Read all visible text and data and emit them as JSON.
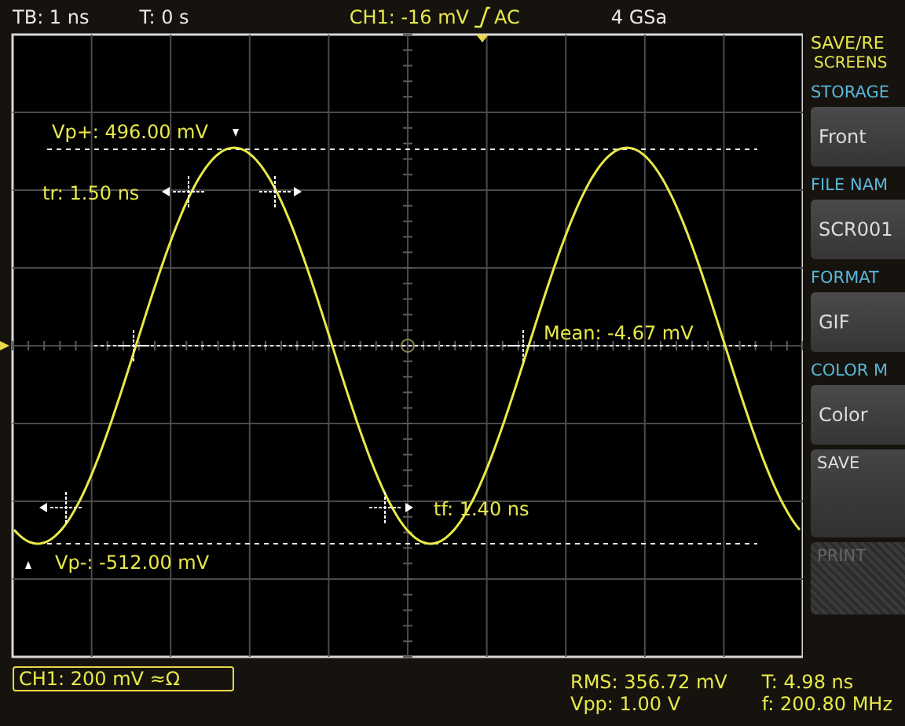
{
  "top_bar": {
    "timebase": "TB: 1 ns",
    "trigger_time": "T: 0 s",
    "channel": "CH1: -16 mV",
    "coupling": "AC",
    "sample_rate": "4 GSa"
  },
  "screen_labels": [
    {
      "kind": "vp_plus",
      "text": "Vp+: 496.00 mV"
    },
    {
      "kind": "rise_time",
      "text": "tr: 1.50 ns"
    },
    {
      "kind": "mean",
      "text": "Mean: -4.67 mV"
    },
    {
      "kind": "fall_time",
      "text": "tf: 1.40 ns"
    },
    {
      "kind": "vp_minus",
      "text": "Vp-: -512.00 mV"
    }
  ],
  "side_menu": {
    "title": [
      "SAVE/RE",
      "SCREENS"
    ],
    "items": [
      {
        "label": "STORAGE",
        "value": "Front"
      },
      {
        "label": "FILE NAM",
        "value": "SCR001"
      },
      {
        "label": "FORMAT",
        "value": "GIF"
      },
      {
        "label": "COLOR M",
        "value": "Color"
      }
    ],
    "buttons": [
      {
        "label": "SAVE",
        "disabled": false
      },
      {
        "label": "PRINT",
        "disabled": true
      }
    ]
  },
  "bottom_bar": {
    "channel_scale": "CH1: 200 mV ≈Ω",
    "readouts": [
      "RMS: 356.72 mV",
      "Vpp: 1.00 V",
      "T: 4.98 ns",
      "f: 200.80 MHz"
    ]
  }
}
